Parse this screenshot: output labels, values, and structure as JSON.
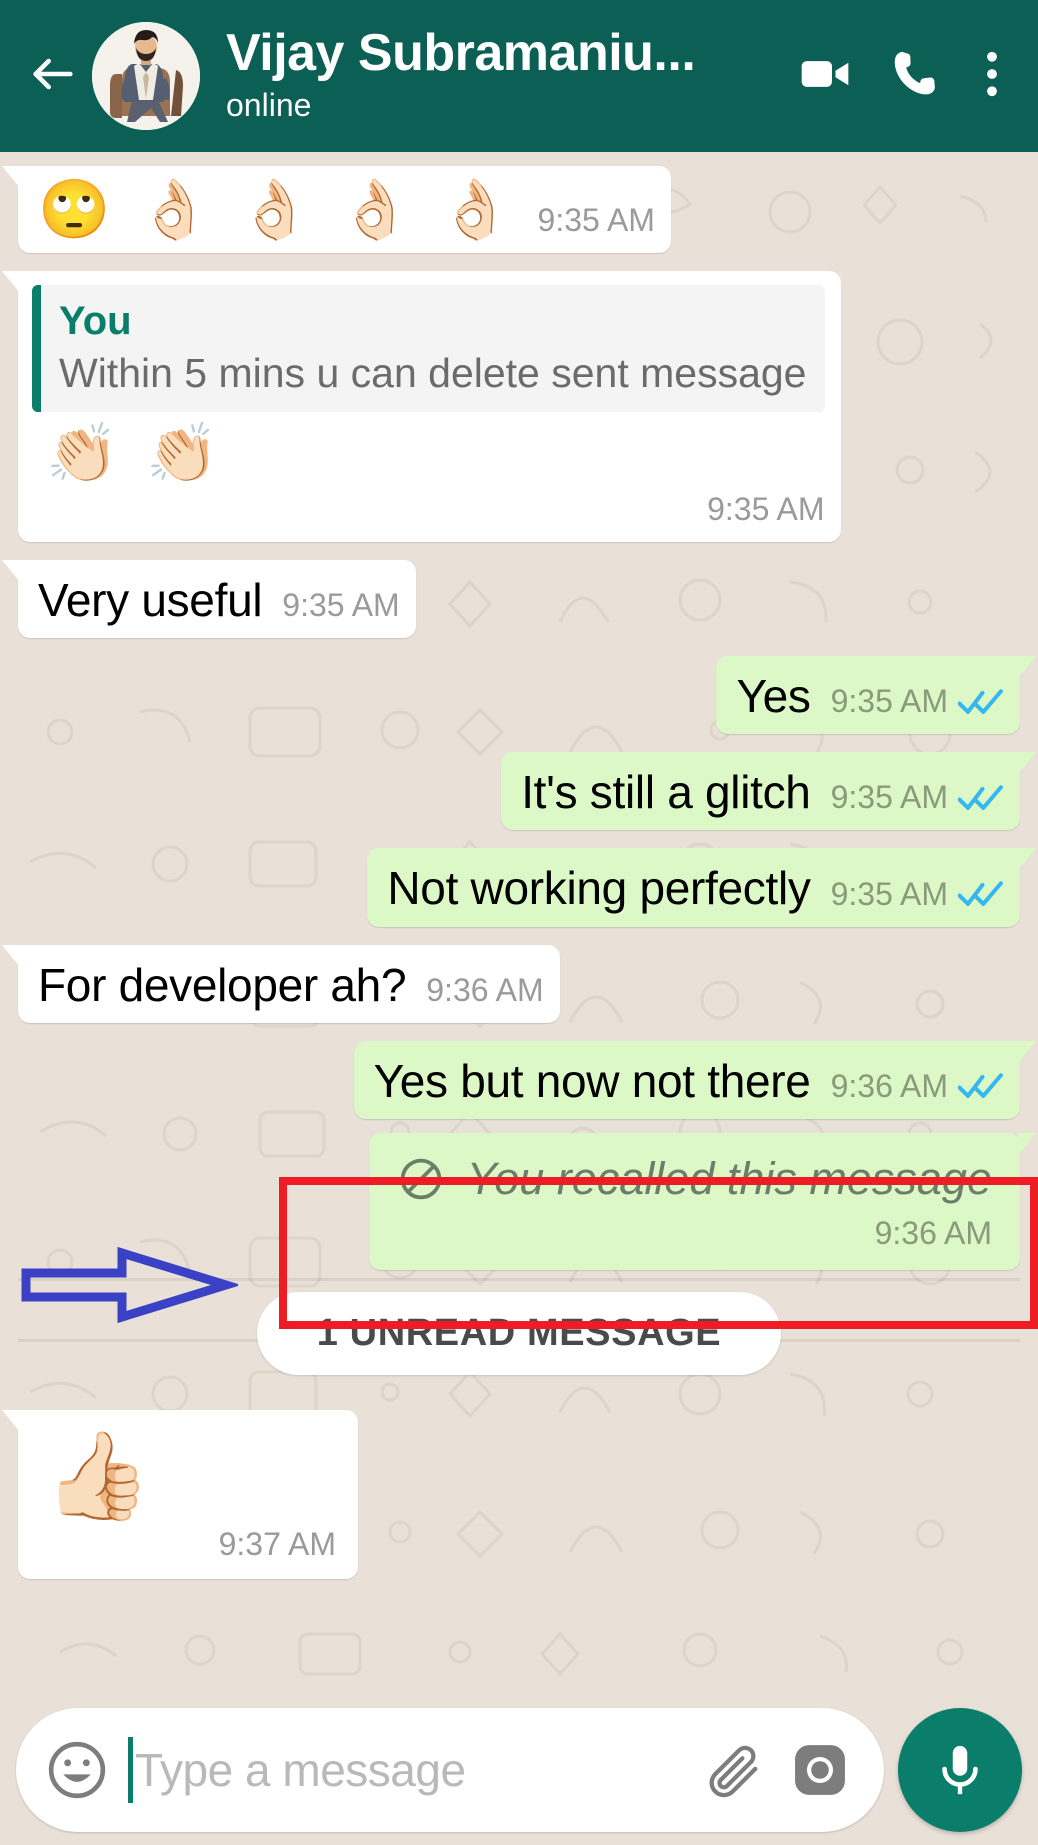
{
  "header": {
    "back_icon": "back-arrow-icon",
    "title": "Vijay Subramaniu...",
    "status": "online",
    "video_call_icon": "video-camera-icon",
    "voice_call_icon": "phone-icon",
    "menu_icon": "overflow-menu-icon",
    "background_color": "#0b5f54"
  },
  "messages": [
    {
      "id": "msg-emoji-ok",
      "direction": "in",
      "kind": "emoji",
      "emoji": "🙄 👌🏻 👌🏻 👌🏻 👌🏻",
      "time": "9:35 AM"
    },
    {
      "id": "msg-quoted-clap",
      "direction": "in",
      "kind": "quoted-emoji",
      "quote_author": "You",
      "quote_text": "Within 5 mins u can delete sent message",
      "emoji": "👏🏻 👏🏻",
      "time": "9:35 AM"
    },
    {
      "id": "msg-very-useful",
      "direction": "in",
      "kind": "text",
      "text": "Very useful",
      "time": "9:35 AM"
    },
    {
      "id": "msg-yes",
      "direction": "out",
      "kind": "text",
      "text": "Yes",
      "time": "9:35 AM",
      "status": "read"
    },
    {
      "id": "msg-glitch",
      "direction": "out",
      "kind": "text",
      "text": "It's still a glitch",
      "time": "9:35 AM",
      "status": "read"
    },
    {
      "id": "msg-not-working",
      "direction": "out",
      "kind": "text",
      "text": "Not working perfectly",
      "time": "9:35 AM",
      "status": "read"
    },
    {
      "id": "msg-developer",
      "direction": "in",
      "kind": "text",
      "text": "For developer ah?",
      "time": "9:36 AM"
    },
    {
      "id": "msg-yes-but",
      "direction": "out",
      "kind": "text",
      "text": "Yes but now not there",
      "time": "9:36 AM",
      "status": "read"
    },
    {
      "id": "msg-recalled",
      "direction": "out",
      "kind": "recalled",
      "text": "You recalled this message",
      "icon": "prohibition-icon",
      "time": "9:36 AM"
    },
    {
      "id": "msg-thumbs-up",
      "direction": "in",
      "kind": "emoji",
      "emoji": "👍🏻",
      "time": "9:37 AM"
    }
  ],
  "unread_divider": {
    "label": "1 UNREAD MESSAGE"
  },
  "composer": {
    "emoji_icon": "smiley-face-icon",
    "placeholder": "Type a message",
    "value": "",
    "attach_icon": "paperclip-icon",
    "camera_icon": "camera-icon",
    "mic_icon": "microphone-icon",
    "send_button_color": "#0b7d6b"
  },
  "annotations": {
    "highlight_box": {
      "name": "recalled-message-highlight",
      "color": "#ee1c25",
      "target": "You recalled this message"
    },
    "pointer_arrow": {
      "name": "blue-pointer-arrow",
      "color": "#3b41c4",
      "direction": "right"
    }
  },
  "colors": {
    "header": "#0b5f54",
    "incoming_bubble": "#ffffff",
    "outgoing_bubble": "#dcf8c6",
    "wallpaper": "#e9e1d8",
    "accent_teal": "#0b7d6b",
    "tick_blue": "#34b7f1",
    "annotation_red": "#ee1c25",
    "annotation_blue": "#3b41c4"
  }
}
